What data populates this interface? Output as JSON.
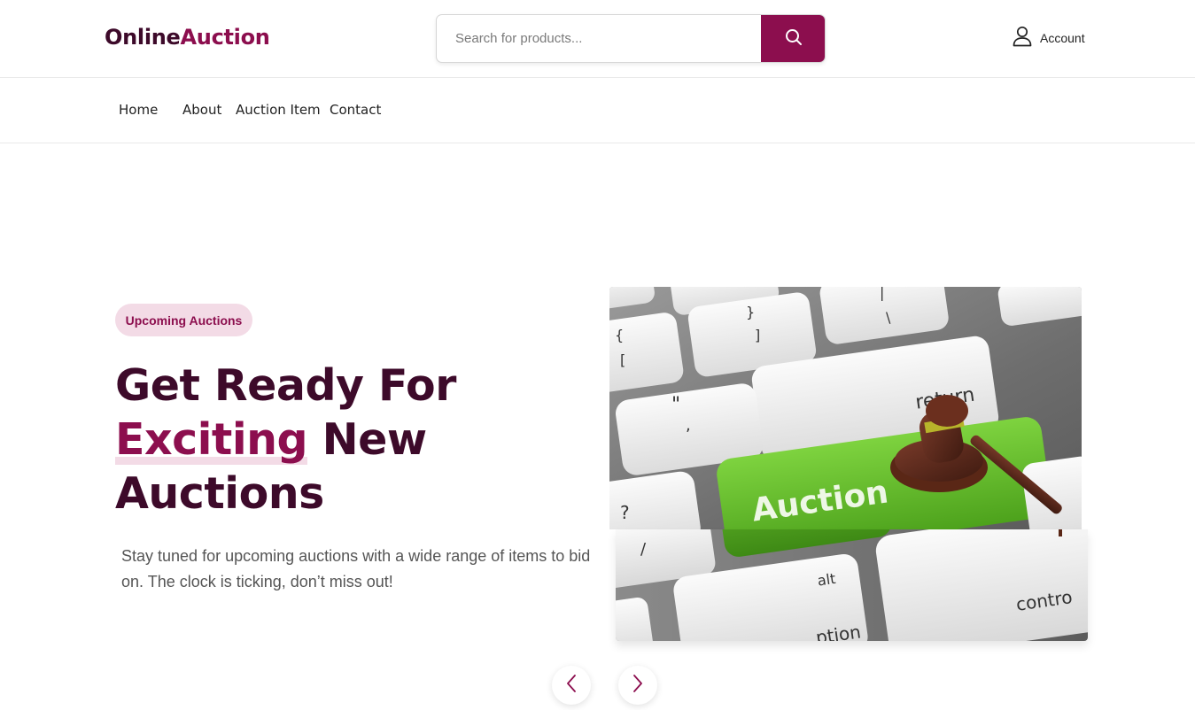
{
  "brand": {
    "part1": "Online",
    "part2": "Auction"
  },
  "search": {
    "placeholder": "Search for products...",
    "value": ""
  },
  "account": {
    "label": "Account"
  },
  "nav": [
    {
      "label": "Home"
    },
    {
      "label": "About"
    },
    {
      "label": "Auction Item"
    },
    {
      "label": "Contact"
    }
  ],
  "hero": {
    "badge": "Upcoming Auctions",
    "title_line1": "Get Ready For",
    "title_accent": "Exciting",
    "title_line2_rest": " New",
    "title_line3": "Auctions",
    "description": "Stay tuned for upcoming auctions with a wide range of items to bid on. The clock is ticking, don’t miss out!",
    "image_key_label": "Auction",
    "image_return_label": "return",
    "image_alt_label": "alt",
    "image_control_label": "contro",
    "image_option_label": "ption"
  },
  "colors": {
    "brand": "#8c0e4e",
    "brand_dark": "#3d0a2a",
    "badge_bg": "#f3dbe6",
    "key_green": "#5cb82a"
  },
  "icons": {
    "search": "search-icon",
    "account": "user-icon",
    "prev": "chevron-left-icon",
    "next": "chevron-right-icon"
  }
}
